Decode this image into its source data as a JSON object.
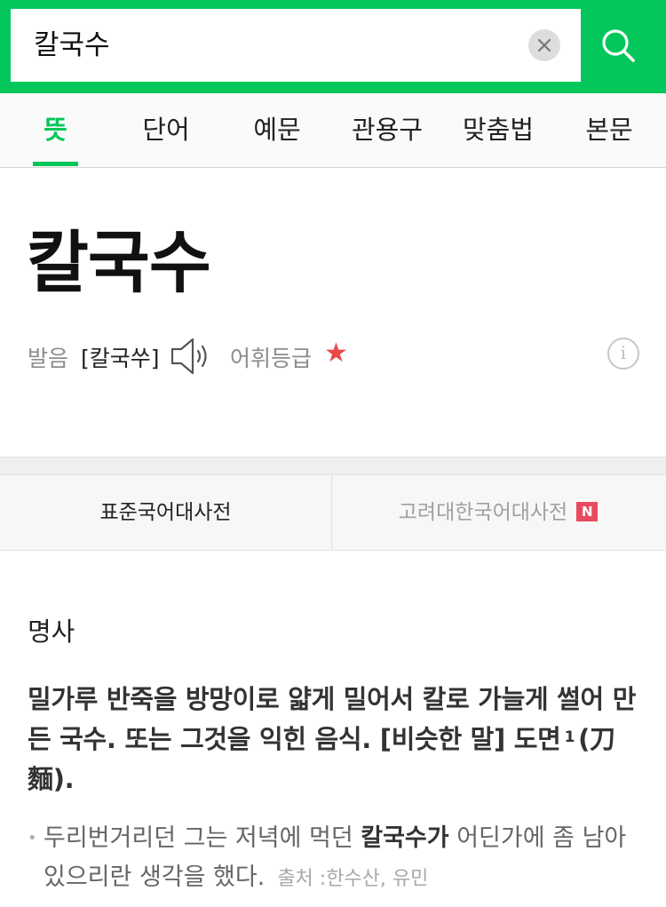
{
  "search": {
    "query": "칼국수",
    "clear_icon": "close-icon",
    "search_icon": "search-icon"
  },
  "tabs": [
    {
      "label": "뜻",
      "active": true
    },
    {
      "label": "단어",
      "active": false
    },
    {
      "label": "예문",
      "active": false
    },
    {
      "label": "관용구",
      "active": false
    },
    {
      "label": "맞춤법",
      "active": false
    },
    {
      "label": "본문",
      "active": false
    }
  ],
  "entry": {
    "headword": "칼국수",
    "pronunciation_label": "발음",
    "pronunciation": "[칼국쑤]",
    "grade_label": "어휘등급",
    "grade_star": "★",
    "info_label": "i"
  },
  "dictionaries": {
    "primary": "표준국어대사전",
    "secondary": "고려대한국어대사전",
    "new_badge": "N"
  },
  "sense": {
    "part_of_speech": "명사",
    "definition_part1": "밀가루 반죽을 방망이로 얇게 밀어서 칼로 가늘게 썰어 만든 국수. 또는 그것을 익힌 음식. [비슷한 말] 도면",
    "definition_sup": "1",
    "definition_part2": "(刀麵).",
    "example_before": "두리번거리던 그는 저녁에 먹던 ",
    "example_bold": "칼국수가",
    "example_after": " 어딘가에 좀 남아 있으리란 생각을 했다.",
    "example_source": "출처 :한수산, 유민"
  },
  "colors": {
    "brand": "#03c75a",
    "star": "#e84a4a",
    "badge": "#e84a5f"
  }
}
